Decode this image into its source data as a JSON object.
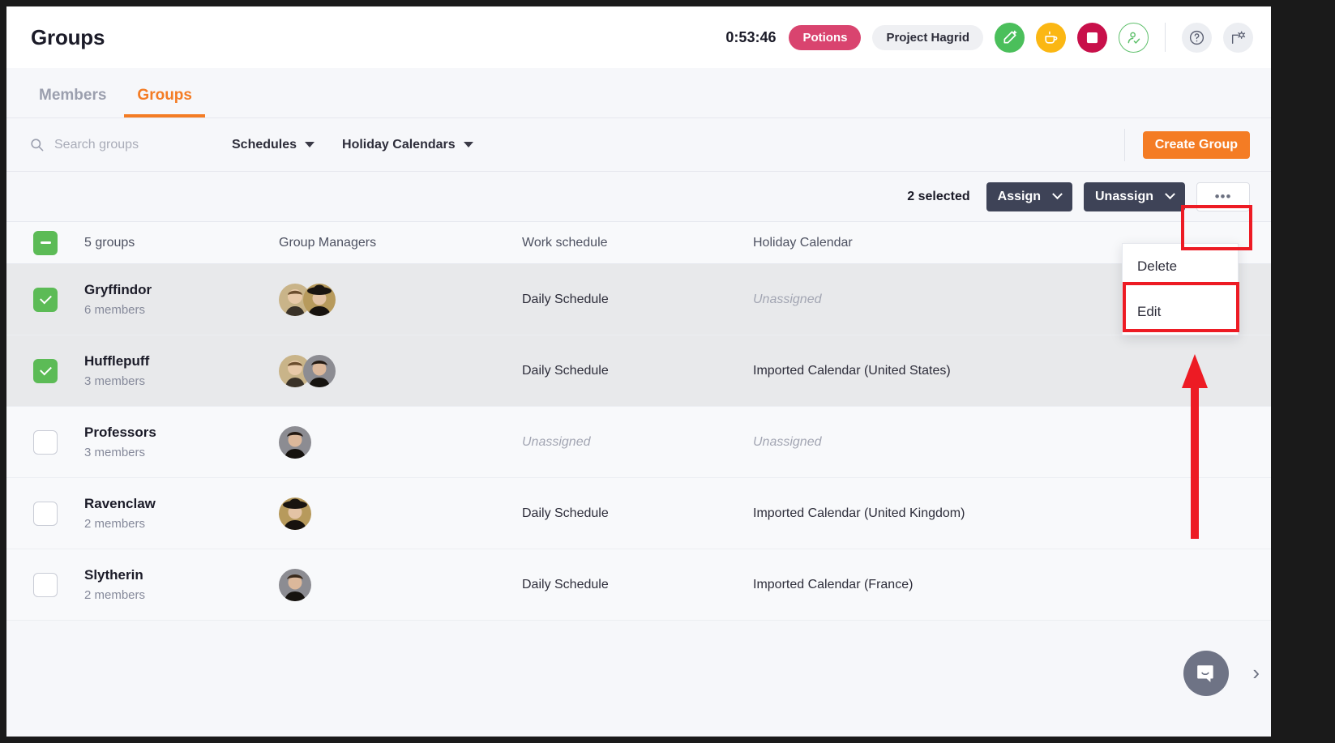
{
  "header": {
    "title": "Groups",
    "timer": "0:53:46",
    "task_pill": "Potions",
    "project_pill": "Project Hagrid",
    "icons": {
      "start": "edit-start-icon",
      "break": "coffee-break-icon",
      "stop": "stop-square-icon",
      "presence": "user-check-icon",
      "help": "help-question-icon",
      "settings": "settings-gear-icon"
    },
    "accent_colors": {
      "task_pill": "#d9446f",
      "green": "#4bbf5b",
      "yellow": "#fbb713",
      "red": "#c8104a",
      "outline_green": "#5fc06c"
    }
  },
  "tabs": [
    {
      "label": "Members",
      "active": false
    },
    {
      "label": "Groups",
      "active": true
    }
  ],
  "filters": {
    "search_placeholder": "Search groups",
    "search_value": "",
    "schedules_label": "Schedules",
    "holiday_label": "Holiday Calendars",
    "create_button": "Create Group",
    "accent": "#f47c24"
  },
  "actionbar": {
    "selected_text": "2 selected",
    "assign_label": "Assign",
    "unassign_label": "Unassign",
    "more_label": "•••"
  },
  "menu": {
    "items": [
      {
        "label": "Delete",
        "highlighted": false
      },
      {
        "label": "Edit",
        "highlighted": true
      }
    ]
  },
  "annotations": {
    "highlight_color": "#ed1b24",
    "boxes": [
      "more-button",
      "edit-menu-item"
    ],
    "arrow": "points-up-to-edit"
  },
  "table": {
    "columns": [
      "5 groups",
      "Group Managers",
      "Work schedule",
      "Holiday Calendar"
    ],
    "select_all_state": "indeterminate",
    "rows": [
      {
        "name": "Gryffindor",
        "members": "6 members",
        "checked": true,
        "managers": 2,
        "schedule": "Daily Schedule",
        "schedule_unassigned": false,
        "calendar": "Unassigned",
        "calendar_unassigned": true
      },
      {
        "name": "Hufflepuff",
        "members": "3 members",
        "checked": true,
        "managers": 2,
        "schedule": "Daily Schedule",
        "schedule_unassigned": false,
        "calendar": "Imported Calendar (United States)",
        "calendar_unassigned": false
      },
      {
        "name": "Professors",
        "members": "3 members",
        "checked": false,
        "managers": 1,
        "schedule": "Unassigned",
        "schedule_unassigned": true,
        "calendar": "Unassigned",
        "calendar_unassigned": true
      },
      {
        "name": "Ravenclaw",
        "members": "2 members",
        "checked": false,
        "managers": 1,
        "schedule": "Daily Schedule",
        "schedule_unassigned": false,
        "calendar": "Imported Calendar (United Kingdom)",
        "calendar_unassigned": false
      },
      {
        "name": "Slytherin",
        "members": "2 members",
        "checked": false,
        "managers": 1,
        "schedule": "Daily Schedule",
        "schedule_unassigned": false,
        "calendar": "Imported Calendar (France)",
        "calendar_unassigned": false
      }
    ]
  },
  "chat": {
    "fab_icon": "chat-bubble-icon",
    "next_icon": "chevron-right-icon"
  }
}
